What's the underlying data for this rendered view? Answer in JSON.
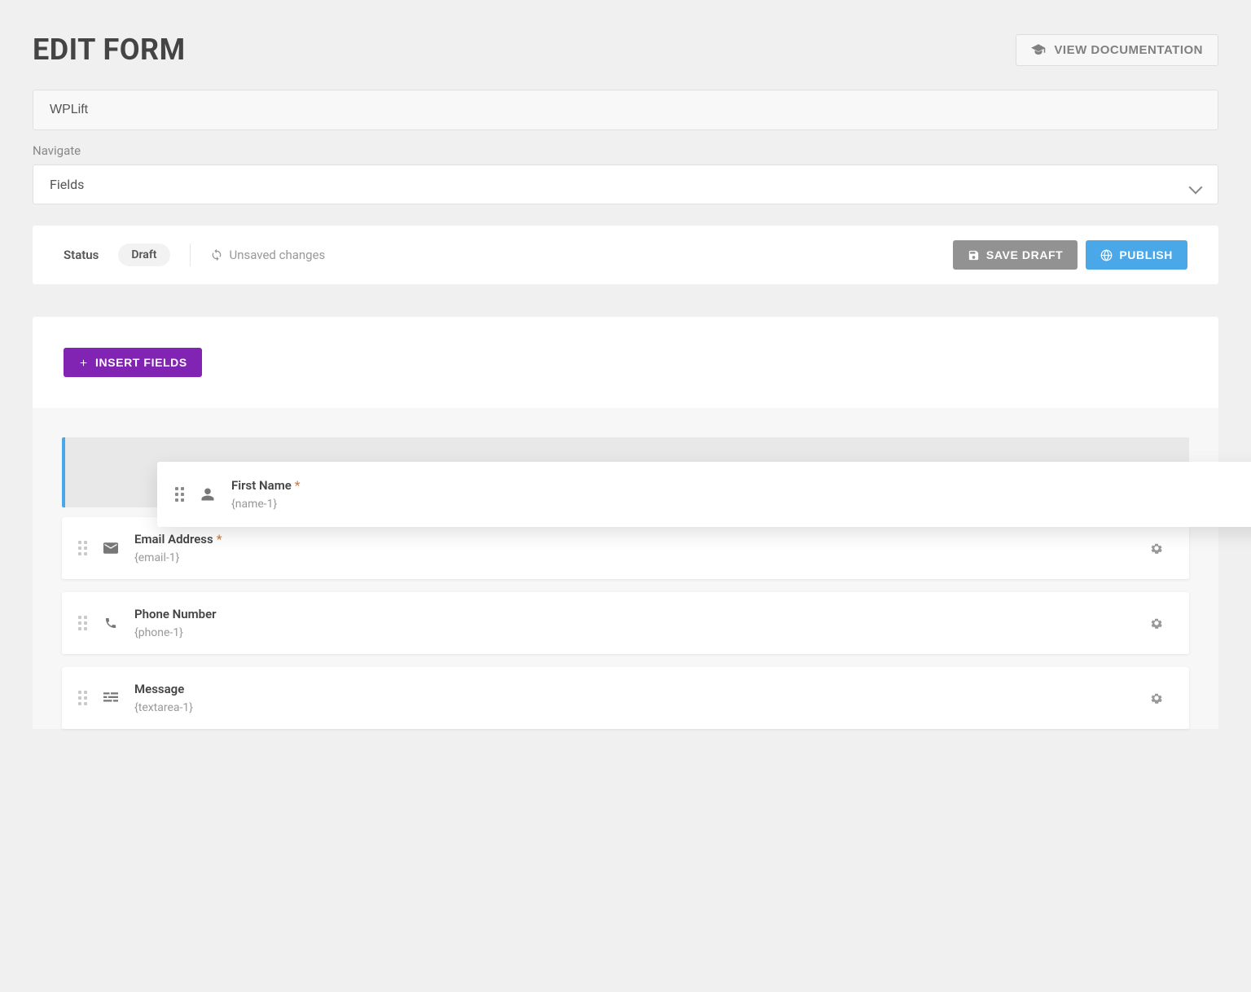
{
  "header": {
    "title": "EDIT FORM",
    "doc_button": "VIEW DOCUMENTATION"
  },
  "form_name": "WPLift",
  "navigate": {
    "label": "Navigate",
    "selected": "Fields"
  },
  "status_bar": {
    "status_label": "Status",
    "status_value": "Draft",
    "unsaved": "Unsaved changes",
    "save_draft": "SAVE DRAFT",
    "publish": "PUBLISH"
  },
  "insert_fields": "INSERT FIELDS",
  "fields": [
    {
      "label": "First Name",
      "tag": "{name-1}",
      "required": true,
      "icon": "user",
      "dragging": true
    },
    {
      "label": "Email Address",
      "tag": "{email-1}",
      "required": true,
      "icon": "envelope",
      "dragging": false
    },
    {
      "label": "Phone Number",
      "tag": "{phone-1}",
      "required": false,
      "icon": "phone",
      "dragging": false
    },
    {
      "label": "Message",
      "tag": "{textarea-1}",
      "required": false,
      "icon": "textarea",
      "dragging": false
    }
  ]
}
